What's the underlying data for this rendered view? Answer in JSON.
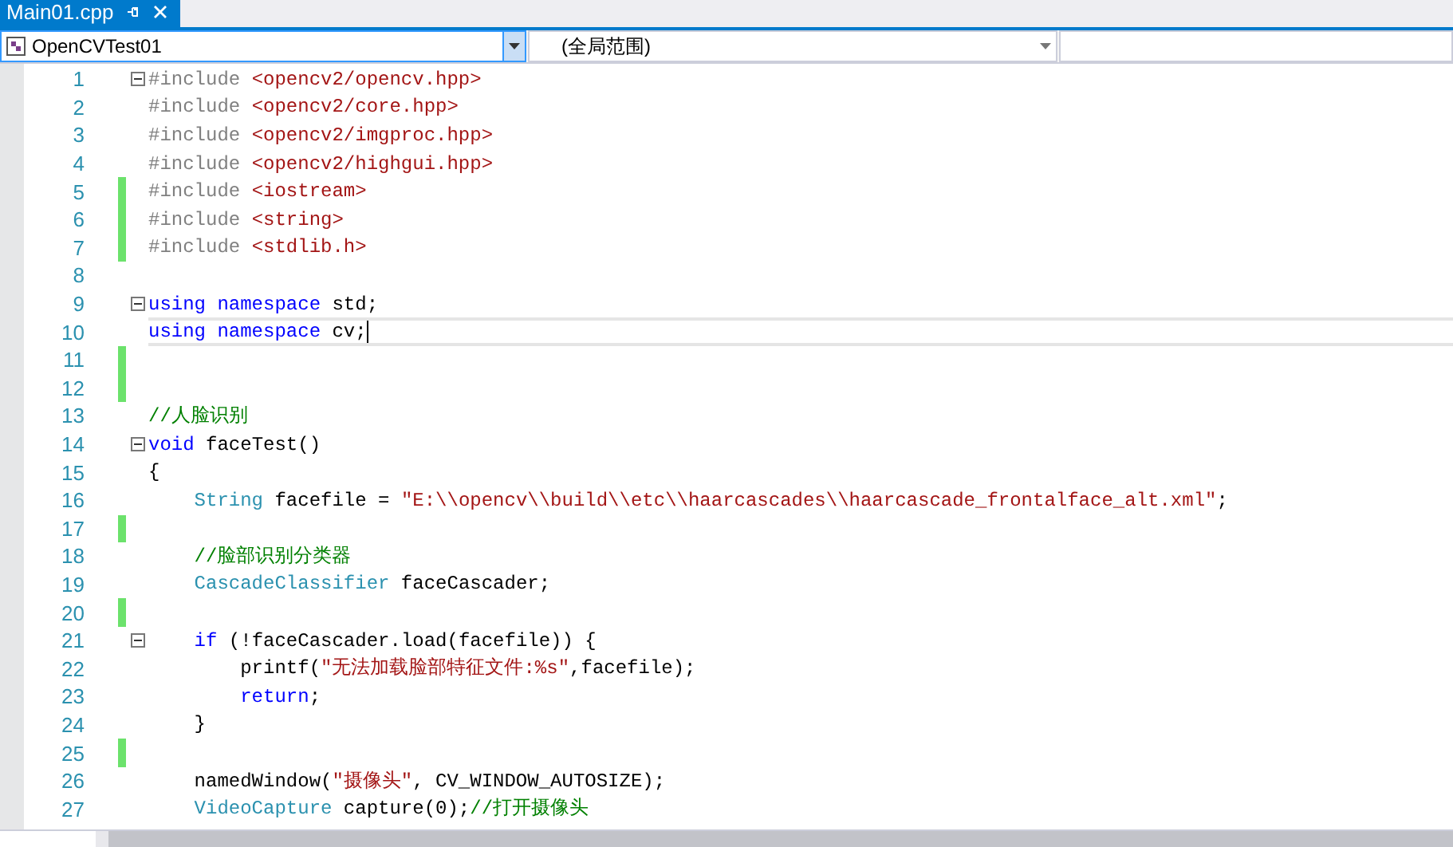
{
  "tabs": [
    {
      "label": "Main01.cpp",
      "selected": true
    }
  ],
  "navigation": {
    "project": "OpenCVTest01",
    "scope": "(全局范围)"
  },
  "lines": [
    {
      "number": "1",
      "changed": false,
      "fold": true,
      "current": false,
      "tokens": [
        {
          "kind": "preproc",
          "text": "#include "
        },
        {
          "kind": "string",
          "text": "<opencv2/opencv.hpp>"
        }
      ]
    },
    {
      "number": "2",
      "changed": false,
      "fold": false,
      "current": false,
      "tokens": [
        {
          "kind": "preproc",
          "text": "#include "
        },
        {
          "kind": "string",
          "text": "<opencv2/core.hpp>"
        }
      ]
    },
    {
      "number": "3",
      "changed": false,
      "fold": false,
      "current": false,
      "tokens": [
        {
          "kind": "preproc",
          "text": "#include "
        },
        {
          "kind": "string",
          "text": "<opencv2/imgproc.hpp>"
        }
      ]
    },
    {
      "number": "4",
      "changed": false,
      "fold": false,
      "current": false,
      "tokens": [
        {
          "kind": "preproc",
          "text": "#include "
        },
        {
          "kind": "string",
          "text": "<opencv2/highgui.hpp>"
        }
      ]
    },
    {
      "number": "5",
      "changed": true,
      "fold": false,
      "current": false,
      "tokens": [
        {
          "kind": "preproc",
          "text": "#include "
        },
        {
          "kind": "string",
          "text": "<iostream>"
        }
      ]
    },
    {
      "number": "6",
      "changed": true,
      "fold": false,
      "current": false,
      "tokens": [
        {
          "kind": "preproc",
          "text": "#include "
        },
        {
          "kind": "string",
          "text": "<string>"
        }
      ]
    },
    {
      "number": "7",
      "changed": true,
      "fold": false,
      "current": false,
      "tokens": [
        {
          "kind": "preproc",
          "text": "#include "
        },
        {
          "kind": "string",
          "text": "<stdlib.h>"
        }
      ]
    },
    {
      "number": "8",
      "changed": false,
      "fold": false,
      "current": false
    },
    {
      "number": "9",
      "changed": false,
      "fold": true,
      "current": false,
      "tokens": [
        {
          "kind": "keyword",
          "text": "using namespace"
        },
        {
          "kind": "plain",
          "text": " std;"
        }
      ]
    },
    {
      "number": "10",
      "changed": false,
      "fold": false,
      "current": true,
      "tokens": [
        {
          "kind": "keyword",
          "text": "using namespace"
        },
        {
          "kind": "plain",
          "text": " cv;"
        }
      ]
    },
    {
      "number": "11",
      "changed": true,
      "fold": false,
      "current": false
    },
    {
      "number": "12",
      "changed": true,
      "fold": false,
      "current": false
    },
    {
      "number": "13",
      "changed": false,
      "fold": false,
      "current": false,
      "tokens": [
        {
          "kind": "comment",
          "text": "//人脸识别"
        }
      ]
    },
    {
      "number": "14",
      "changed": false,
      "fold": true,
      "current": false,
      "tokens": [
        {
          "kind": "keyword",
          "text": "void"
        },
        {
          "kind": "plain",
          "text": " faceTest()"
        }
      ]
    },
    {
      "number": "15",
      "changed": false,
      "fold": false,
      "current": false,
      "tokens": [
        {
          "kind": "plain",
          "text": "{"
        }
      ]
    },
    {
      "number": "16",
      "changed": false,
      "fold": false,
      "current": false,
      "tokens": [
        {
          "kind": "type",
          "text": "    String"
        },
        {
          "kind": "plain",
          "text": " facefile = "
        },
        {
          "kind": "string",
          "text": "\"E:\\\\opencv\\\\build\\\\etc\\\\haarcascades\\\\haarcascade_frontalface_alt.xml\""
        },
        {
          "kind": "plain",
          "text": ";"
        }
      ]
    },
    {
      "number": "17",
      "changed": true,
      "fold": false,
      "current": false
    },
    {
      "number": "18",
      "changed": false,
      "fold": false,
      "current": false,
      "tokens": [
        {
          "kind": "comment",
          "text": "    //脸部识别分类器"
        }
      ]
    },
    {
      "number": "19",
      "changed": false,
      "fold": false,
      "current": false,
      "tokens": [
        {
          "kind": "type",
          "text": "    CascadeClassifier"
        },
        {
          "kind": "plain",
          "text": " faceCascader;"
        }
      ]
    },
    {
      "number": "20",
      "changed": true,
      "fold": false,
      "current": false
    },
    {
      "number": "21",
      "changed": false,
      "fold": true,
      "current": false,
      "tokens": [
        {
          "kind": "keyword",
          "text": "    if"
        },
        {
          "kind": "plain",
          "text": " (!faceCascader.load(facefile)) {"
        }
      ]
    },
    {
      "number": "22",
      "changed": false,
      "fold": false,
      "current": false,
      "tokens": [
        {
          "kind": "plain",
          "text": "        printf("
        },
        {
          "kind": "string",
          "text": "\"无法加载脸部特征文件:%s\""
        },
        {
          "kind": "plain",
          "text": ",facefile);"
        }
      ]
    },
    {
      "number": "23",
      "changed": false,
      "fold": false,
      "current": false,
      "tokens": [
        {
          "kind": "keyword",
          "text": "        return"
        },
        {
          "kind": "plain",
          "text": ";"
        }
      ]
    },
    {
      "number": "24",
      "changed": false,
      "fold": false,
      "current": false,
      "tokens": [
        {
          "kind": "plain",
          "text": "    }"
        }
      ]
    },
    {
      "number": "25",
      "changed": true,
      "fold": false,
      "current": false
    },
    {
      "number": "26",
      "changed": false,
      "fold": false,
      "current": false,
      "tokens": [
        {
          "kind": "plain",
          "text": "    namedWindow("
        },
        {
          "kind": "string",
          "text": "\"摄像头\""
        },
        {
          "kind": "plain",
          "text": ", CV_WINDOW_AUTOSIZE);"
        }
      ]
    },
    {
      "number": "27",
      "changed": false,
      "fold": false,
      "current": false,
      "tokens": [
        {
          "kind": "type",
          "text": "    VideoCapture"
        },
        {
          "kind": "plain",
          "text": " capture(0);"
        },
        {
          "kind": "comment",
          "text": "//打开摄像头"
        }
      ]
    }
  ]
}
